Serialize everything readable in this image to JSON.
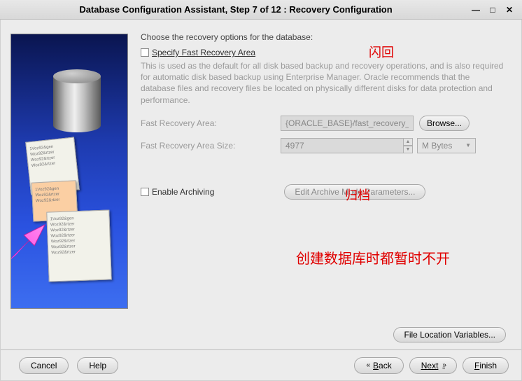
{
  "window": {
    "title": "Database Configuration Assistant, Step 7 of 12 : Recovery Configuration"
  },
  "main": {
    "prompt": "Choose the recovery options for the database:",
    "specifyFastRecovery": {
      "label": "Specify Fast Recovery Area",
      "checked": false
    },
    "description": "This is used as the default for all disk based backup and recovery operations, and is also required for automatic disk based backup using Enterprise Manager. Oracle recommends that the database files and recovery files be located on physically different disks for data protection and performance.",
    "fastRecoveryArea": {
      "label": "Fast Recovery Area:",
      "value": "{ORACLE_BASE}/fast_recovery_a",
      "browse": "Browse..."
    },
    "fastRecoveryAreaSize": {
      "label": "Fast Recovery Area Size:",
      "value": "4977",
      "unit": "M Bytes"
    },
    "enableArchiving": {
      "label": "Enable Archiving",
      "checked": false,
      "editBtn": "Edit Archive Mode Parameters..."
    },
    "fileLocationVars": "File Location Variables..."
  },
  "annotations": {
    "flashback": "闪回",
    "archive": "归档",
    "bottomNote": "创建数据库时都暂时不开"
  },
  "footer": {
    "cancel": "Cancel",
    "help": "Help",
    "back": "Back",
    "next": "Next",
    "finish": "Finish"
  }
}
